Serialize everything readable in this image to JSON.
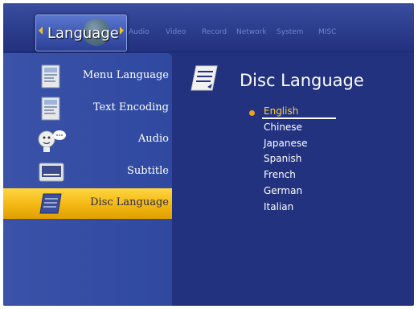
{
  "header": {
    "active_tab": "Language",
    "tabs": [
      {
        "label": "Audio"
      },
      {
        "label": "Video"
      },
      {
        "label": "Record"
      },
      {
        "label": "Network"
      },
      {
        "label": "System"
      },
      {
        "label": "MISC"
      }
    ]
  },
  "sidebar": {
    "items": [
      {
        "label": "Menu Language",
        "icon": "menu-language-icon",
        "selected": false
      },
      {
        "label": "Text Encoding",
        "icon": "text-encoding-icon",
        "selected": false
      },
      {
        "label": "Audio",
        "icon": "audio-speech-icon",
        "selected": false
      },
      {
        "label": "Subtitle",
        "icon": "subtitle-screen-icon",
        "selected": false
      },
      {
        "label": "Disc Language",
        "icon": "disc-language-icon",
        "selected": true
      }
    ]
  },
  "panel": {
    "title": "Disc Language",
    "icon": "disc-language-icon",
    "options": [
      {
        "label": "English",
        "selected": true
      },
      {
        "label": "Chinese",
        "selected": false
      },
      {
        "label": "Japanese",
        "selected": false
      },
      {
        "label": "Spanish",
        "selected": false
      },
      {
        "label": "French",
        "selected": false
      },
      {
        "label": "German",
        "selected": false
      },
      {
        "label": "Italian",
        "selected": false
      }
    ]
  },
  "colors": {
    "background": "#22327f",
    "sidebar": "#3a52a8",
    "selection": "#f3b712",
    "selected_text": "#ffd23a",
    "inactive_tab": "#6f84cf"
  }
}
